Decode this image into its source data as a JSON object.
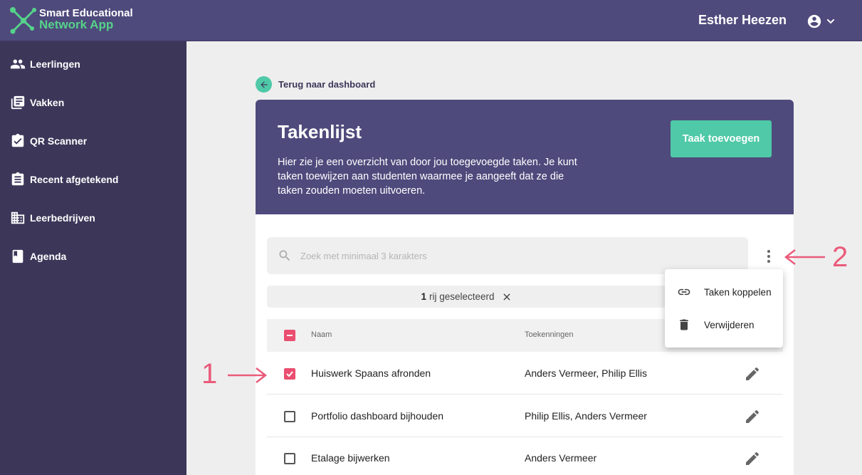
{
  "app": {
    "logo_line1": "Smart Educational",
    "logo_line2": "Network App",
    "user_name": "Esther Heezen"
  },
  "sidebar": {
    "items": [
      {
        "label": "Leerlingen",
        "icon": "people-icon"
      },
      {
        "label": "Vakken",
        "icon": "library-books-icon"
      },
      {
        "label": "QR Scanner",
        "icon": "assignment-check-icon"
      },
      {
        "label": "Recent afgetekend",
        "icon": "assignment-icon"
      },
      {
        "label": "Leerbedrijven",
        "icon": "business-icon"
      },
      {
        "label": "Agenda",
        "icon": "book-icon"
      }
    ]
  },
  "back_link": "Terug naar dashboard",
  "header": {
    "title": "Takenlijst",
    "description": "Hier zie je een overzicht van door jou toegevoegde taken. Je kunt taken toewijzen aan studenten waarmee je aangeeft dat ze die taken zouden moeten uitvoeren.",
    "add_button": "Taak toevoegen"
  },
  "search": {
    "placeholder": "Zoek met minimaal 3 karakters",
    "value": ""
  },
  "selection": {
    "count": "1",
    "text": "rij geselecteerd"
  },
  "table": {
    "columns": [
      "Naam",
      "Toekenningen"
    ],
    "rows": [
      {
        "name": "Huiswerk Spaans afronden",
        "assignments": "Anders Vermeer, Philip Ellis",
        "checked": true
      },
      {
        "name": "Portfolio dashboard bijhouden",
        "assignments": "Philip Ellis, Anders Vermeer",
        "checked": false
      },
      {
        "name": "Etalage bijwerken",
        "assignments": "Anders Vermeer",
        "checked": false
      }
    ]
  },
  "menu": {
    "items": [
      {
        "label": "Taken koppelen",
        "icon": "link-icon"
      },
      {
        "label": "Verwijderen",
        "icon": "trash-icon"
      }
    ]
  },
  "annotations": {
    "one": "1",
    "two": "2",
    "color": "#ea5b7a"
  },
  "colors": {
    "primary": "#4f4a7c",
    "sidebar": "#3c3759",
    "accent": "#4fc9a7",
    "checkbox": "#ea4e70"
  }
}
